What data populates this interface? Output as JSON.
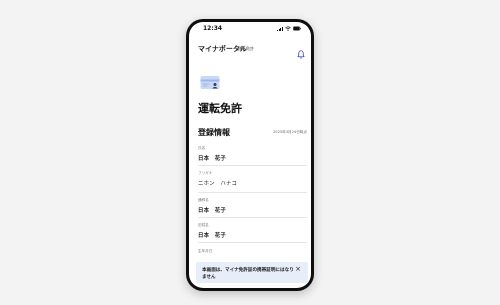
{
  "status_bar": {
    "time": "12:34"
  },
  "header": {
    "title": "マイナポータル",
    "subtitle": "運転免許"
  },
  "page": {
    "title": "運転免許"
  },
  "section": {
    "title": "登録情報",
    "date": "2025年3月24日時点"
  },
  "fields": [
    {
      "label": "氏名",
      "value": "日本　花子"
    },
    {
      "label": "フリガナ",
      "value": "ニホン　ハナコ"
    },
    {
      "label": "通称名",
      "value": "日本　花子"
    },
    {
      "label": "旧姓名",
      "value": "日本　花子"
    },
    {
      "label": "生年月日",
      "value": ""
    }
  ],
  "notice": {
    "text": "本画面は、マイナ免許証の携帯証明にはなりません",
    "close": "×"
  },
  "colors": {
    "accent": "#3b4cc0",
    "notice_bg": "#e7eef9"
  },
  "icons": [
    "bell-icon",
    "license-card-icon",
    "close-icon"
  ]
}
